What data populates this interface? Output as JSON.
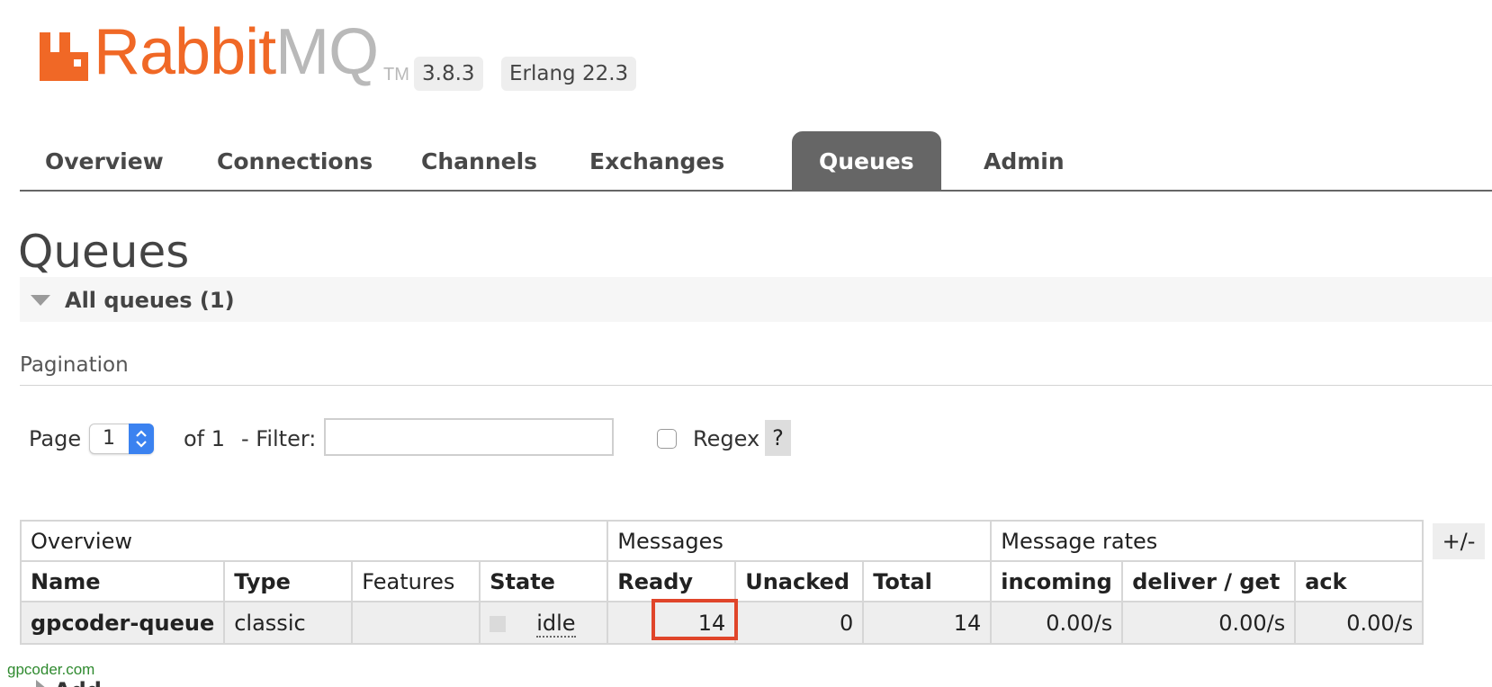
{
  "header": {
    "logo_part1": "Rabbit",
    "logo_part2": "MQ",
    "trademark": "TM",
    "version": "3.8.3",
    "erlang": "Erlang 22.3",
    "brand_color": "#f06826"
  },
  "tabs": [
    {
      "label": "Overview",
      "active": false
    },
    {
      "label": "Connections",
      "active": false
    },
    {
      "label": "Channels",
      "active": false
    },
    {
      "label": "Exchanges",
      "active": false
    },
    {
      "label": "Queues",
      "active": true
    },
    {
      "label": "Admin",
      "active": false
    }
  ],
  "page_title": "Queues",
  "section": {
    "title": "All queues (1)",
    "icon": "collapse-caret-icon"
  },
  "pagination": {
    "label": "Pagination",
    "page_label": "Page",
    "page_value": "1",
    "of_label": "of 1",
    "filter_label": "- Filter:",
    "filter_value": "",
    "regex_label": "Regex",
    "regex_checked": false,
    "help_label": "?"
  },
  "table": {
    "groups": [
      "Overview",
      "Messages",
      "Message rates"
    ],
    "columns": [
      "Name",
      "Type",
      "Features",
      "State",
      "Ready",
      "Unacked",
      "Total",
      "incoming",
      "deliver / get",
      "ack"
    ],
    "rows": [
      {
        "name": "gpcoder-queue",
        "type": "classic",
        "features": "",
        "state": "idle",
        "ready": "14",
        "unacked": "0",
        "total": "14",
        "incoming": "0.00/s",
        "deliver_get": "0.00/s",
        "ack": "0.00/s"
      }
    ],
    "toggle_columns_label": "+/-",
    "highlight_color": "#e0452a"
  },
  "watermark": "gpcoder.com",
  "cutoff_section": "Add"
}
